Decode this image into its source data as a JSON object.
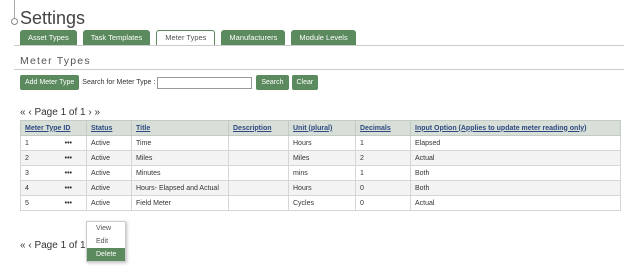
{
  "page": {
    "title": "Settings"
  },
  "tabs": [
    {
      "label": "Asset Types",
      "active": false
    },
    {
      "label": "Task Templates",
      "active": false
    },
    {
      "label": "Meter Types",
      "active": true
    },
    {
      "label": "Manufacturers",
      "active": false
    },
    {
      "label": "Module Levels",
      "active": false
    }
  ],
  "section": {
    "title": "Meter Types"
  },
  "toolbar": {
    "add_label": "Add Meter Type",
    "search_label": "Search for Meter Type :",
    "search_value": "",
    "search_button": "Search",
    "clear_button": "Clear"
  },
  "pager": {
    "top": "« ‹ Page 1 of 1 › »",
    "bottom": "« ‹ Page 1 of 1"
  },
  "table": {
    "columns": [
      "Meter Type ID",
      "Status",
      "Title",
      "Description",
      "Unit (plural)",
      "Decimals",
      "Input Option (Applies to update meter reading only)"
    ],
    "rows": [
      {
        "id": "1",
        "actions": "•••",
        "status": "Active",
        "title": "Time",
        "description": "",
        "unit": "Hours",
        "decimals": "1",
        "input_option": "Elapsed"
      },
      {
        "id": "2",
        "actions": "•••",
        "status": "Active",
        "title": "Miles",
        "description": "",
        "unit": "Miles",
        "decimals": "2",
        "input_option": "Actual"
      },
      {
        "id": "3",
        "actions": "•••",
        "status": "Active",
        "title": "Minutes",
        "description": "",
        "unit": "mins",
        "decimals": "1",
        "input_option": "Both"
      },
      {
        "id": "4",
        "actions": "•••",
        "status": "Active",
        "title": "Hours- Elapsed and Actual",
        "description": "",
        "unit": "Hours",
        "decimals": "0",
        "input_option": "Both"
      },
      {
        "id": "5",
        "actions": "•••",
        "status": "Active",
        "title": "Field Meter",
        "description": "",
        "unit": "Cycles",
        "decimals": "0",
        "input_option": "Actual"
      }
    ]
  },
  "context_menu": {
    "items": [
      {
        "label": "View",
        "active": false
      },
      {
        "label": "Edit",
        "active": false
      },
      {
        "label": "Delete",
        "active": true
      }
    ]
  },
  "colors": {
    "accent": "#5b8a5e",
    "header_bg": "#d8dfd8",
    "header_text": "#2e4a80"
  }
}
